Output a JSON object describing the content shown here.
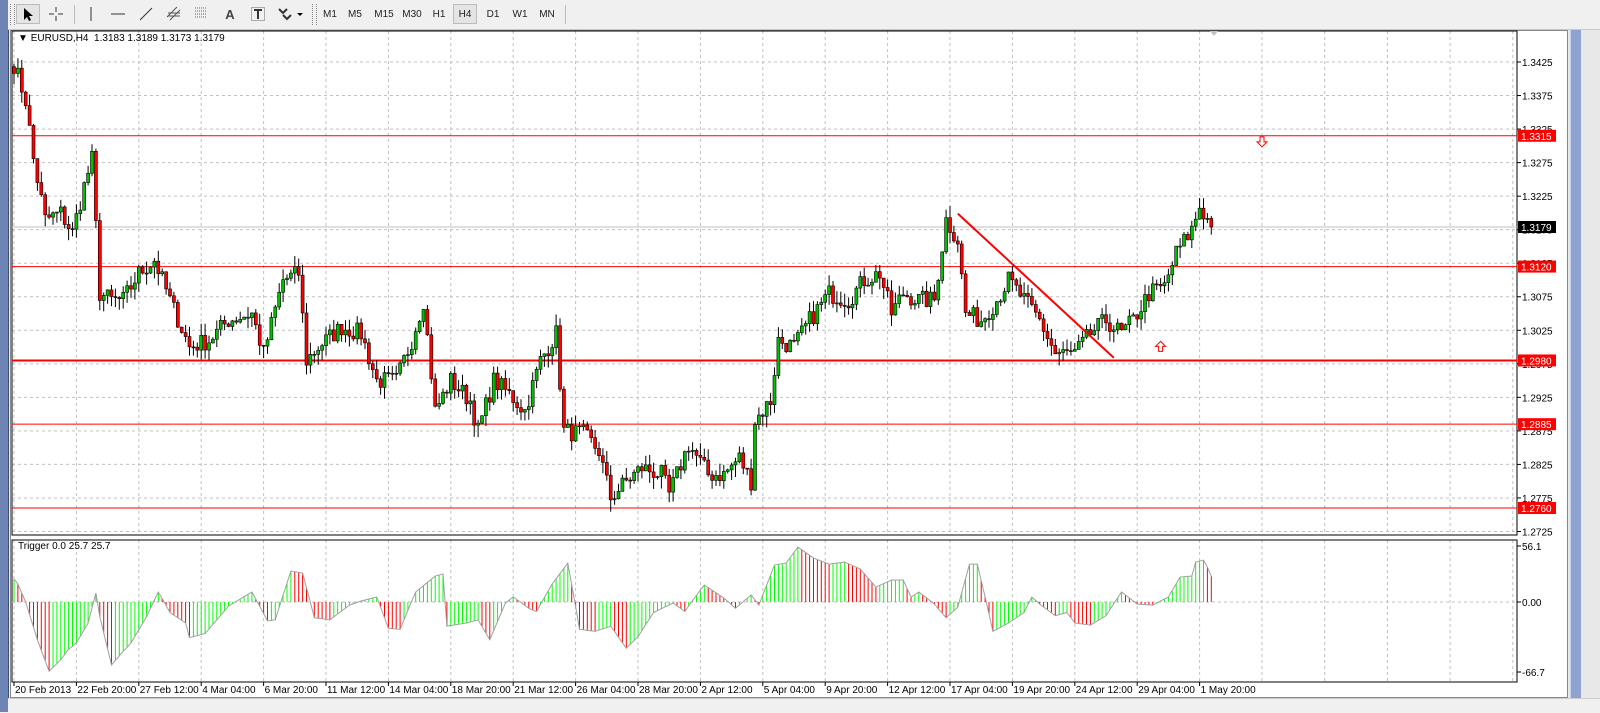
{
  "toolbar": {
    "tools": [
      "cursor-icon",
      "crosshair-icon",
      "vertical-line-icon",
      "horizontal-line-icon",
      "trendline-icon",
      "equidistant-channel-icon",
      "fibonacci-icon",
      "text-icon",
      "text-label-icon",
      "arrows-icon"
    ],
    "text_tool_label": "A",
    "timeframes": [
      "M1",
      "M5",
      "M15",
      "M30",
      "H1",
      "H4",
      "D1",
      "W1",
      "MN"
    ],
    "active_timeframe": "H4"
  },
  "chart": {
    "symbol_header": "EURUSD,H4",
    "ohlc_header": "1.3183 1.3189 1.3173 1.3179",
    "indicator_header": "Trigger 0.0 25.7 25.7",
    "current_price": "1.3179",
    "price_ticks": [
      "1.3425",
      "1.3375",
      "1.3325",
      "1.3275",
      "1.3225",
      "1.3175",
      "1.3125",
      "1.3075",
      "1.3025",
      "1.2975",
      "1.2925",
      "1.2875",
      "1.2825",
      "1.2775",
      "1.2725"
    ],
    "indicator_ticks": [
      "56.1",
      "0.00",
      "-66.7"
    ],
    "time_labels": [
      "20 Feb 2013",
      "22 Feb 20:00",
      "27 Feb 12:00",
      "4 Mar 04:00",
      "6 Mar 20:00",
      "11 Mar 12:00",
      "14 Mar 04:00",
      "18 Mar 20:00",
      "21 Mar 12:00",
      "26 Mar 04:00",
      "28 Mar 20:00",
      "2 Apr 12:00",
      "5 Apr 04:00",
      "9 Apr 20:00",
      "12 Apr 12:00",
      "17 Apr 04:00",
      "19 Apr 20:00",
      "24 Apr 12:00",
      "29 Apr 04:00",
      "1 May 20:00"
    ],
    "levels": [
      {
        "label": "1.3315",
        "price": 1.3315,
        "thick": false
      },
      {
        "label": "1.3120",
        "price": 1.312,
        "thick": false
      },
      {
        "label": "1.2980",
        "price": 1.298,
        "thick": true
      },
      {
        "label": "1.2885",
        "price": 1.2885,
        "thick": false
      },
      {
        "label": "1.2760",
        "price": 1.276,
        "thick": false
      }
    ],
    "colors": {
      "bull": "#00c000",
      "bear": "#ff0000",
      "level": "#ff0000",
      "indicator_up": "#00ff00",
      "indicator_down": "#ff0000",
      "grid": "#c0c0c0"
    }
  },
  "chart_data": {
    "type": "candlestick",
    "symbol": "EURUSD",
    "timeframe": "H4",
    "ylim": [
      1.2715,
      1.344
    ],
    "close_anchors_bar_price": [
      [
        0,
        1.3422
      ],
      [
        3,
        1.3368
      ],
      [
        5,
        1.328
      ],
      [
        8,
        1.319
      ],
      [
        12,
        1.32
      ],
      [
        15,
        1.317
      ],
      [
        18,
        1.324
      ],
      [
        20,
        1.328
      ],
      [
        22,
        1.308
      ],
      [
        25,
        1.307
      ],
      [
        28,
        1.307
      ],
      [
        32,
        1.311
      ],
      [
        36,
        1.313
      ],
      [
        40,
        1.307
      ],
      [
        45,
        1.3
      ],
      [
        50,
        1.301
      ],
      [
        55,
        1.304
      ],
      [
        61,
        1.305
      ],
      [
        64,
        1.299
      ],
      [
        69,
        1.31
      ],
      [
        73,
        1.311
      ],
      [
        75,
        1.298
      ],
      [
        78,
        1.3
      ],
      [
        84,
        1.303
      ],
      [
        89,
        1.302
      ],
      [
        93,
        1.295
      ],
      [
        98,
        1.295
      ],
      [
        102,
        1.301
      ],
      [
        105,
        1.307
      ],
      [
        108,
        1.2905
      ],
      [
        112,
        1.295
      ],
      [
        117,
        1.292
      ],
      [
        119,
        1.2875
      ],
      [
        123,
        1.295
      ],
      [
        127,
        1.293
      ],
      [
        131,
        1.2905
      ],
      [
        135,
        1.298
      ],
      [
        139,
        1.302
      ],
      [
        141,
        1.2875
      ],
      [
        146,
        1.287
      ],
      [
        150,
        1.2845
      ],
      [
        153,
        1.2775
      ],
      [
        157,
        1.28
      ],
      [
        161,
        1.282
      ],
      [
        166,
        1.281
      ],
      [
        168,
        1.278
      ],
      [
        173,
        1.2855
      ],
      [
        178,
        1.281
      ],
      [
        182,
        1.281
      ],
      [
        186,
        1.2835
      ],
      [
        189,
        1.28
      ],
      [
        190,
        1.289
      ],
      [
        194,
        1.292
      ],
      [
        196,
        1.301
      ],
      [
        200,
        1.3
      ],
      [
        204,
        1.304
      ],
      [
        209,
        1.308
      ],
      [
        214,
        1.307
      ],
      [
        218,
        1.31
      ],
      [
        222,
        1.311
      ],
      [
        225,
        1.305
      ],
      [
        228,
        1.308
      ],
      [
        232,
        1.307
      ],
      [
        236,
        1.307
      ],
      [
        239,
        1.319
      ],
      [
        242,
        1.316
      ],
      [
        244,
        1.305
      ],
      [
        248,
        1.304
      ],
      [
        252,
        1.307
      ],
      [
        255,
        1.31
      ],
      [
        259,
        1.307
      ],
      [
        263,
        1.304
      ],
      [
        267,
        1.299
      ],
      [
        272,
        1.299
      ],
      [
        276,
        1.302
      ],
      [
        280,
        1.304
      ],
      [
        284,
        1.302
      ],
      [
        287,
        1.304
      ],
      [
        291,
        1.308
      ],
      [
        295,
        1.309
      ],
      [
        298,
        1.314
      ],
      [
        302,
        1.3175
      ],
      [
        304,
        1.321
      ],
      [
        307,
        1.3179
      ]
    ],
    "trendline": {
      "from": {
        "bar": 242,
        "price": 1.3199
      },
      "to": {
        "bar": 282,
        "price": 1.2984
      }
    },
    "arrows": [
      {
        "type": "sell",
        "bar": 320,
        "price": 1.3306
      },
      {
        "type": "buy",
        "bar": 294,
        "price": 1.3001
      }
    ],
    "indicator": {
      "name": "Trigger",
      "ylim": [
        -66.7,
        56.1
      ],
      "anchors_bar_value": [
        [
          0,
          23
        ],
        [
          1,
          18
        ],
        [
          3,
          0
        ],
        [
          6,
          -36
        ],
        [
          9,
          -66
        ],
        [
          12,
          -55
        ],
        [
          14,
          -45
        ],
        [
          16,
          -39
        ],
        [
          19,
          -20
        ],
        [
          21,
          9
        ],
        [
          22,
          -14
        ],
        [
          25,
          -60
        ],
        [
          28,
          -47
        ],
        [
          30,
          -39
        ],
        [
          34,
          -14
        ],
        [
          37,
          10
        ],
        [
          40,
          -10
        ],
        [
          44,
          -20
        ],
        [
          45,
          -34
        ],
        [
          49,
          -30
        ],
        [
          55,
          -4
        ],
        [
          61,
          10
        ],
        [
          65,
          -18
        ],
        [
          67,
          -17
        ],
        [
          71,
          31
        ],
        [
          74,
          29
        ],
        [
          77,
          -15
        ],
        [
          81,
          -17
        ],
        [
          86,
          -3
        ],
        [
          89,
          1
        ],
        [
          93,
          5
        ],
        [
          96,
          -25
        ],
        [
          99,
          -26
        ],
        [
          103,
          10
        ],
        [
          108,
          26
        ],
        [
          110,
          28
        ],
        [
          111,
          -23
        ],
        [
          116,
          -20
        ],
        [
          119,
          -17
        ],
        [
          122,
          -36
        ],
        [
          126,
          -1
        ],
        [
          128,
          5
        ],
        [
          132,
          -6
        ],
        [
          134,
          -9
        ],
        [
          138,
          18
        ],
        [
          142,
          39
        ],
        [
          145,
          -26
        ],
        [
          149,
          -28
        ],
        [
          153,
          -23
        ],
        [
          157,
          -44
        ],
        [
          160,
          -33
        ],
        [
          164,
          -10
        ],
        [
          169,
          -1
        ],
        [
          172,
          -9
        ],
        [
          177,
          17
        ],
        [
          182,
          4
        ],
        [
          185,
          -6
        ],
        [
          189,
          7
        ],
        [
          191,
          -3
        ],
        [
          195,
          37
        ],
        [
          198,
          39
        ],
        [
          201,
          55
        ],
        [
          205,
          44
        ],
        [
          209,
          38
        ],
        [
          213,
          40
        ],
        [
          217,
          33
        ],
        [
          221,
          15
        ],
        [
          225,
          22
        ],
        [
          228,
          22
        ],
        [
          230,
          5
        ],
        [
          232,
          10
        ],
        [
          236,
          -2
        ],
        [
          239,
          -15
        ],
        [
          242,
          -5
        ],
        [
          245,
          38
        ],
        [
          247,
          38
        ],
        [
          251,
          -28
        ],
        [
          255,
          -20
        ],
        [
          259,
          -10
        ],
        [
          261,
          5
        ],
        [
          263,
          -2
        ],
        [
          267,
          -13
        ],
        [
          270,
          -10
        ],
        [
          272,
          -20
        ],
        [
          276,
          -22
        ],
        [
          280,
          -13
        ],
        [
          284,
          10
        ],
        [
          288,
          -2
        ],
        [
          292,
          -3
        ],
        [
          296,
          5
        ],
        [
          299,
          25
        ],
        [
          302,
          26
        ],
        [
          303,
          40
        ],
        [
          305,
          42
        ],
        [
          306,
          35
        ],
        [
          307,
          25.7
        ]
      ]
    }
  }
}
